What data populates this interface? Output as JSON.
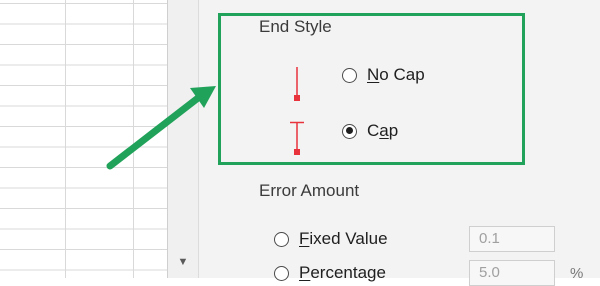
{
  "end_style": {
    "heading": "End Style",
    "options": [
      {
        "access_key": "N",
        "rest": "o Cap",
        "checked": false
      },
      {
        "pre": "C",
        "access_key": "a",
        "post": "p",
        "checked": true
      }
    ]
  },
  "error_amount": {
    "heading": "Error Amount",
    "fixed_value": {
      "access_key": "F",
      "rest": "ixed Value",
      "value": "0.1"
    },
    "percentage": {
      "access_key": "P",
      "rest": "ercentage",
      "value": "5.0",
      "unit": "%"
    }
  },
  "colors": {
    "highlight": "#21a25a",
    "cap_marker": "#e8323c",
    "pane_background": "#f3f3f3"
  },
  "icons": [
    "no-cap-preview-icon",
    "cap-preview-icon",
    "scroll-down-arrow-icon",
    "callout-arrow-icon"
  ]
}
